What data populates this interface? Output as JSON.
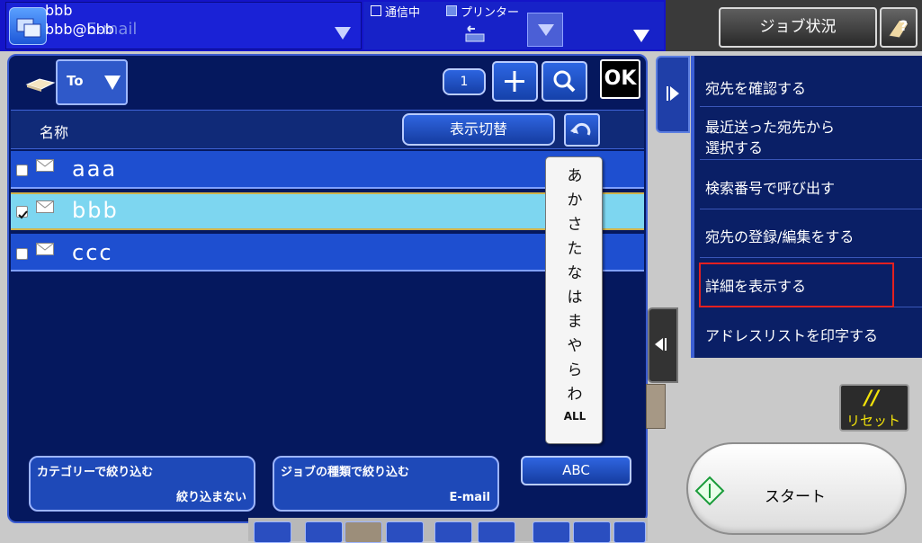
{
  "header": {
    "user_name": "bbb",
    "user_email": "bbb@bbb",
    "ghost_mode": "E-mail",
    "status_comm": "通信中",
    "status_printer": "プリンター",
    "job_status_btn": "ジョブ状況"
  },
  "address_panel": {
    "to_label": "To",
    "count": "1",
    "ok_label": "OK",
    "name_header": "名称",
    "toggle_view_btn": "表示切替",
    "rows": [
      {
        "name": "aaa",
        "checked": false
      },
      {
        "name": "bbb",
        "checked": true
      },
      {
        "name": "ccc",
        "checked": false
      }
    ],
    "kana_index": [
      "あ",
      "か",
      "さ",
      "た",
      "な",
      "は",
      "ま",
      "や",
      "ら",
      "わ",
      "ALL"
    ],
    "category_filter": {
      "title": "カテゴリーで絞り込む",
      "value": "絞り込まない"
    },
    "job_type_filter": {
      "title": "ジョブの種類で絞り込む",
      "value": "E-mail"
    },
    "abc_btn": "ABC"
  },
  "side_menu": {
    "items": [
      "宛先を確認する",
      "最近送った宛先から",
      "選択する",
      "検索番号で呼び出す",
      "宛先の登録/編集をする",
      "詳細を表示する",
      "アドレスリストを印字する"
    ]
  },
  "reset_btn": {
    "symbol": "//",
    "label": "リセット"
  },
  "start_btn": "スタート",
  "colors": {
    "panel": "#05185e",
    "row": "#1e4fd0",
    "row_selected": "#7dd6f0",
    "highlight_box": "#e32020"
  }
}
